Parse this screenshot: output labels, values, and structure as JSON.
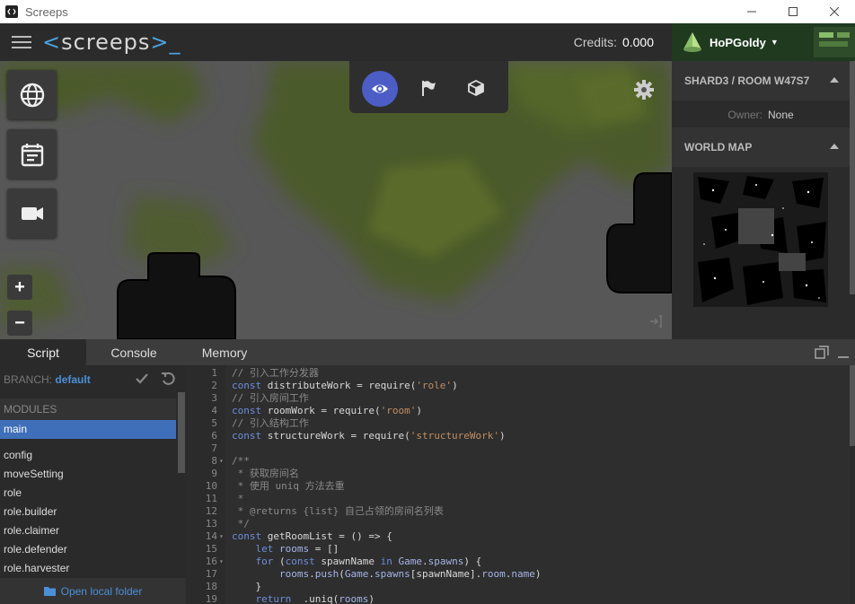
{
  "window": {
    "title": "Screeps",
    "controls": [
      "minimize",
      "maximize",
      "close"
    ]
  },
  "header": {
    "logo": "screeps",
    "credits_label": "Credits:",
    "credits_value": "0.000"
  },
  "user": {
    "name": "HoPGoldy"
  },
  "map_toolbar": {
    "views": [
      "view-mode",
      "flag-mode",
      "structure-mode"
    ],
    "active_view": "view-mode"
  },
  "room_panel": {
    "title": "SHARD3 / ROOM W47S7",
    "owner_label": "Owner:",
    "owner_value": "None"
  },
  "world_map_panel": {
    "title": "WORLD MAP"
  },
  "bottom_panel": {
    "tabs": [
      "Script",
      "Console",
      "Memory"
    ],
    "active_tab": "Script"
  },
  "script": {
    "branch_label": "BRANCH:",
    "branch_value": "default",
    "modules_header": "MODULES",
    "modules": [
      "main",
      "config",
      "moveSetting",
      "role",
      "role.builder",
      "role.claimer",
      "role.defender",
      "role.harvester"
    ],
    "active_module": "main",
    "open_folder": "Open local folder"
  },
  "code": {
    "lines": [
      {
        "n": "1",
        "fold": "",
        "t": "// 引入工作分发器"
      },
      {
        "n": "2",
        "fold": "",
        "t": "const distributeWork = require('role')"
      },
      {
        "n": "3",
        "fold": "",
        "t": "// 引入房间工作"
      },
      {
        "n": "4",
        "fold": "",
        "t": "const roomWork = require('room')"
      },
      {
        "n": "5",
        "fold": "",
        "t": "// 引入结构工作"
      },
      {
        "n": "6",
        "fold": "",
        "t": "const structureWork = require('structureWork')"
      },
      {
        "n": "7",
        "fold": "",
        "t": ""
      },
      {
        "n": "8",
        "fold": "▾",
        "t": "/**"
      },
      {
        "n": "9",
        "fold": "",
        "t": " * 获取房间名"
      },
      {
        "n": "10",
        "fold": "",
        "t": " * 使用 uniq 方法去重"
      },
      {
        "n": "11",
        "fold": "",
        "t": " *"
      },
      {
        "n": "12",
        "fold": "",
        "t": " * @returns {list} 自己占领的房间名列表"
      },
      {
        "n": "13",
        "fold": "",
        "t": " */"
      },
      {
        "n": "14",
        "fold": "▾",
        "t": "const getRoomList = () => {"
      },
      {
        "n": "15",
        "fold": "",
        "t": "    let rooms = []"
      },
      {
        "n": "16",
        "fold": "▾",
        "t": "    for (const spawnName in Game.spawns) {"
      },
      {
        "n": "17",
        "fold": "",
        "t": "        rooms.push(Game.spawns[spawnName].room.name)"
      },
      {
        "n": "18",
        "fold": "",
        "t": "    }"
      },
      {
        "n": "19",
        "fold": "",
        "t": "    return _.uniq(rooms)"
      }
    ]
  },
  "colors": {
    "accent_blue": "#4b8fd8",
    "active_view": "#4c5ec6",
    "module_active": "#3f6fb8",
    "user_bar": "#1f3a1f"
  }
}
